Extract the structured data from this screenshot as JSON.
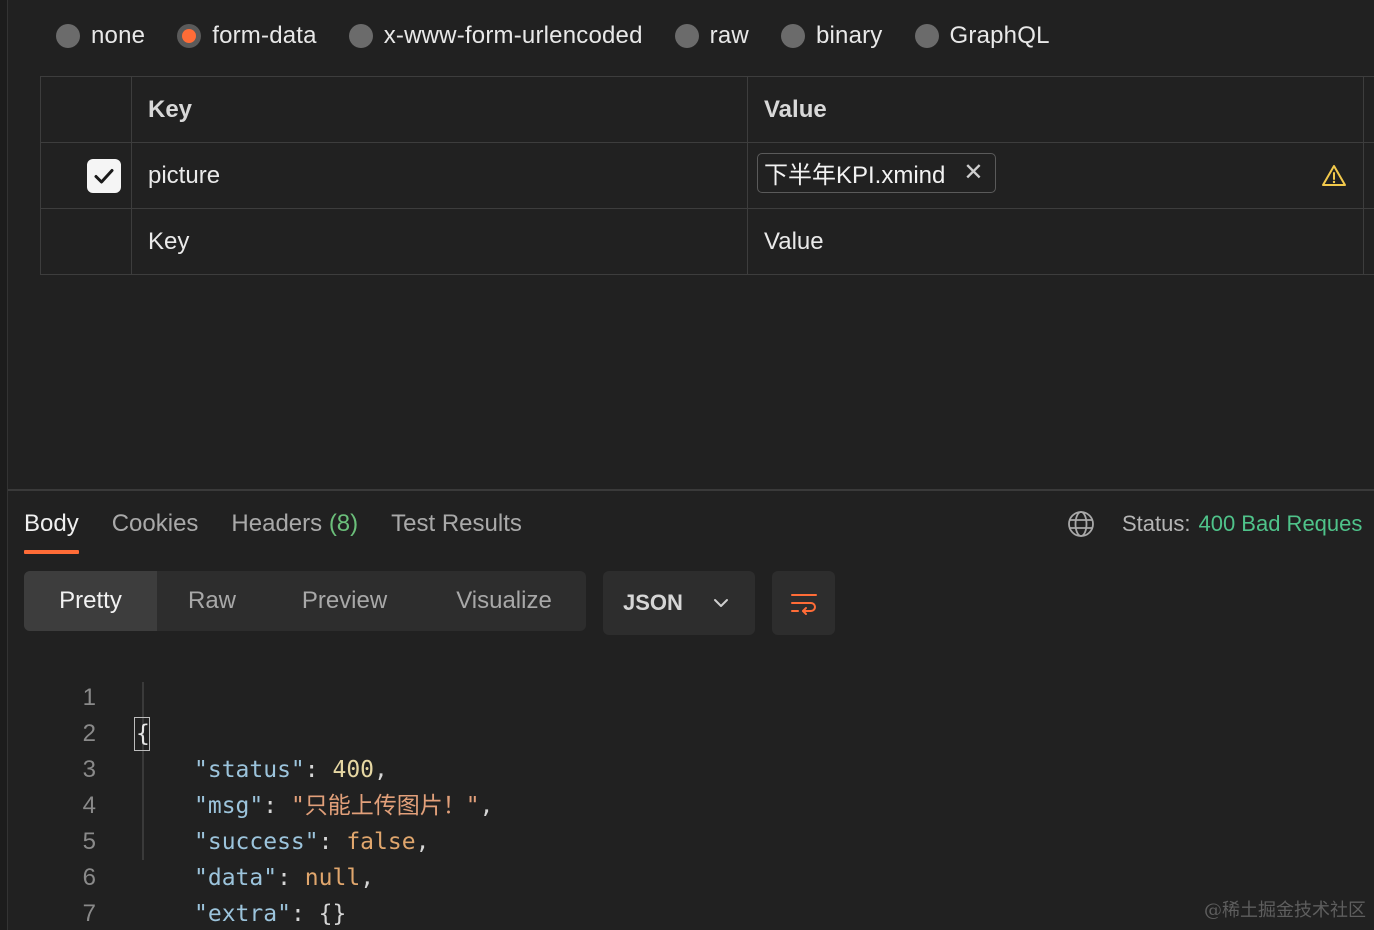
{
  "body_types": {
    "options": [
      {
        "label": "none",
        "selected": false
      },
      {
        "label": "form-data",
        "selected": true
      },
      {
        "label": "x-www-form-urlencoded",
        "selected": false
      },
      {
        "label": "raw",
        "selected": false
      },
      {
        "label": "binary",
        "selected": false
      },
      {
        "label": "GraphQL",
        "selected": false
      }
    ]
  },
  "table": {
    "headers": {
      "key": "Key",
      "value": "Value"
    },
    "rows": [
      {
        "checked": true,
        "key": "picture",
        "file": "下半年KPI.xmind",
        "warning": true
      }
    ],
    "new_row": {
      "key_placeholder": "Key",
      "value_placeholder": "Value"
    }
  },
  "response": {
    "tabs": [
      {
        "label": "Body",
        "active": true
      },
      {
        "label": "Cookies",
        "active": false
      },
      {
        "label": "Headers",
        "count": "(8)",
        "active": false
      },
      {
        "label": "Test Results",
        "active": false
      }
    ],
    "status_label": "Status:",
    "status_value": "400 Bad Reques",
    "views": [
      "Pretty",
      "Raw",
      "Preview",
      "Visualize"
    ],
    "active_view": "Pretty",
    "format": "JSON",
    "code": {
      "line_numbers": [
        "1",
        "2",
        "3",
        "4",
        "5",
        "6",
        "7"
      ],
      "open_brace": "{",
      "close_brace": "}",
      "fields": [
        {
          "key": "\"status\"",
          "value": "400",
          "type": "number"
        },
        {
          "key": "\"msg\"",
          "value": "\"只能上传图片！\"",
          "type": "string"
        },
        {
          "key": "\"success\"",
          "value": "false",
          "type": "boolean"
        },
        {
          "key": "\"data\"",
          "value": "null",
          "type": "null"
        },
        {
          "key": "\"extra\"",
          "value": "{}",
          "type": "object"
        }
      ]
    }
  },
  "watermark": "@稀土掘金技术社区",
  "colors": {
    "accent": "#ff6c37",
    "status_ok_green": "#4fc38a",
    "background": "#212121"
  }
}
